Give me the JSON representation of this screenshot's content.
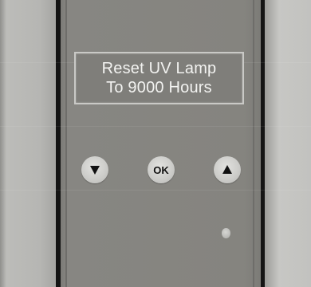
{
  "display": {
    "line1": "Reset UV Lamp",
    "line2": "To 9000 Hours"
  },
  "buttons": {
    "down_icon": "triangle-down-icon",
    "ok_label": "OK",
    "up_icon": "triangle-up-icon"
  },
  "colors": {
    "panel": "#85847f",
    "display_text": "#f3f3f1",
    "display_border": "#c9c9c6",
    "button": "#cdcdca"
  }
}
